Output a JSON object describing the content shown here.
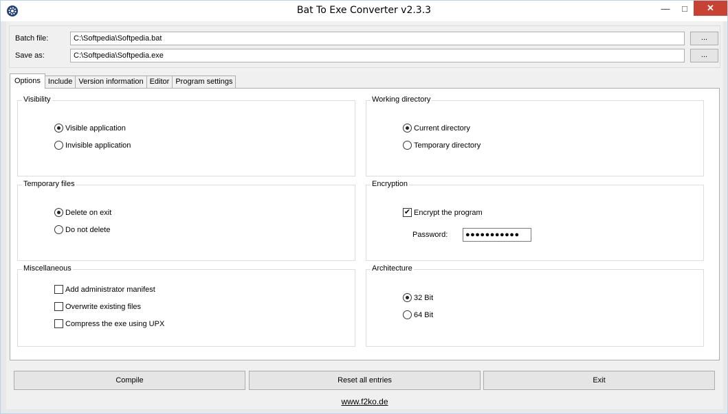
{
  "window": {
    "title": "Bat To Exe Converter v2.3.3",
    "min": "—",
    "max": "□",
    "close": "✕"
  },
  "files": {
    "batch_label": "Batch file:",
    "batch_value": "C:\\Softpedia\\Softpedia.bat",
    "save_label": "Save as:",
    "save_value": "C:\\Softpedia\\Softpedia.exe",
    "browse": "..."
  },
  "tabs": [
    "Options",
    "Include",
    "Version information",
    "Editor",
    "Program settings"
  ],
  "options": {
    "visibility": {
      "title": "Visibility",
      "items": [
        "Visible application",
        "Invisible application"
      ]
    },
    "working_directory": {
      "title": "Working directory",
      "items": [
        "Current directory",
        "Temporary directory"
      ]
    },
    "temporary_files": {
      "title": "Temporary files",
      "items": [
        "Delete on exit",
        "Do not delete"
      ]
    },
    "encryption": {
      "title": "Encryption",
      "encrypt_label": "Encrypt the program",
      "password_label": "Password:",
      "password_value": "●●●●●●●●●●●"
    },
    "miscellaneous": {
      "title": "Miscellaneous",
      "items": [
        "Add administrator manifest",
        "Overwrite existing files",
        "Compress the exe using UPX"
      ]
    },
    "architecture": {
      "title": "Architecture",
      "items": [
        "32 Bit",
        "64 Bit"
      ]
    }
  },
  "buttons": {
    "compile": "Compile",
    "reset": "Reset all entries",
    "exit": "Exit"
  },
  "footer_link": "www.f2ko.de",
  "checkmark": "✔"
}
